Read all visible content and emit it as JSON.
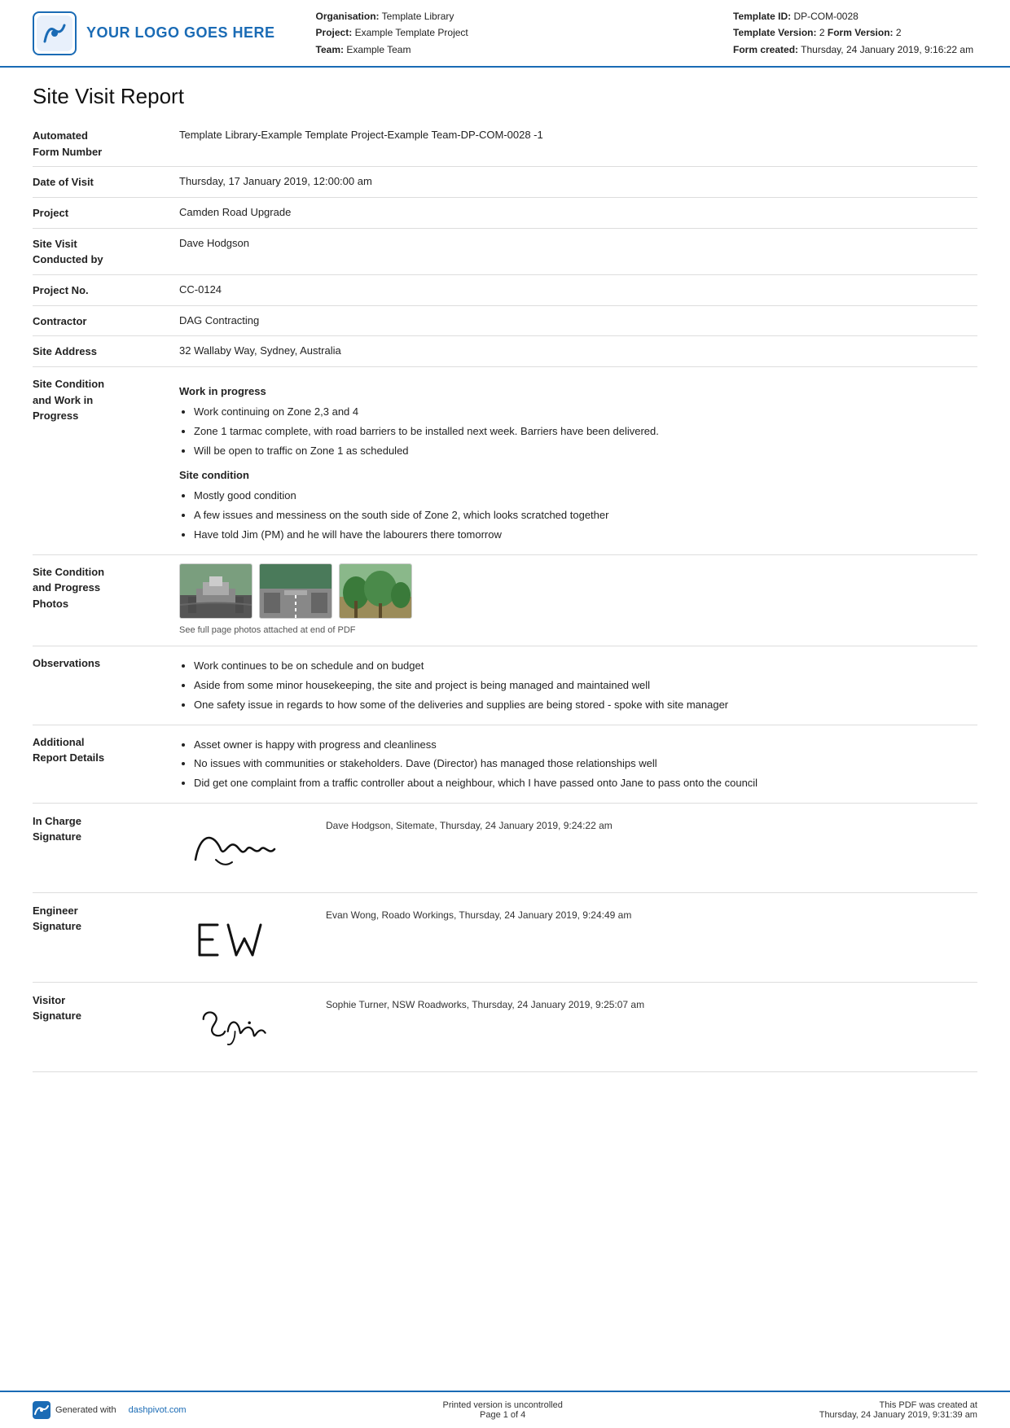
{
  "header": {
    "logo_text": "YOUR LOGO GOES HERE",
    "org_label": "Organisation:",
    "org_value": "Template Library",
    "project_label": "Project:",
    "project_value": "Example Template Project",
    "team_label": "Team:",
    "team_value": "Example Team",
    "template_id_label": "Template ID:",
    "template_id_value": "DP-COM-0028",
    "template_version_label": "Template Version:",
    "template_version_value": "2",
    "form_version_label": "Form Version:",
    "form_version_value": "2",
    "form_created_label": "Form created:",
    "form_created_value": "Thursday, 24 January 2019, 9:16:22 am"
  },
  "title": "Site Visit Report",
  "fields": {
    "form_number_label": "Automated\nForm Number",
    "form_number_value": "Template Library-Example Template Project-Example Team-DP-COM-0028   -1",
    "date_of_visit_label": "Date of Visit",
    "date_of_visit_value": "Thursday, 17 January 2019, 12:00:00 am",
    "project_label": "Project",
    "project_value": "Camden Road Upgrade",
    "site_visit_label": "Site Visit\nConducted by",
    "site_visit_value": "Dave Hodgson",
    "project_no_label": "Project No.",
    "project_no_value": "CC-0124",
    "contractor_label": "Contractor",
    "contractor_value": "DAG Contracting",
    "site_address_label": "Site Address",
    "site_address_value": "32 Wallaby Way, Sydney, Australia",
    "site_condition_label": "Site Condition\nand Work in\nProgress",
    "site_condition_heading1": "Work in progress",
    "site_condition_bullets1": [
      "Work continuing on Zone 2,3 and 4",
      "Zone 1 tarmac complete, with road barriers to be installed next week. Barriers have been delivered.",
      "Will be open to traffic on Zone 1 as scheduled"
    ],
    "site_condition_heading2": "Site condition",
    "site_condition_bullets2": [
      "Mostly good condition",
      "A few issues and messiness on the south side of Zone 2, which looks scratched together",
      "Have told Jim (PM) and he will have the labourers there tomorrow"
    ],
    "photos_label": "Site Condition\nand Progress\nPhotos",
    "photos_caption": "See full page photos attached at end of PDF",
    "observations_label": "Observations",
    "observations_bullets": [
      "Work continues to be on schedule and on budget",
      "Aside from some minor housekeeping, the site and project is being managed and maintained well",
      "One safety issue in regards to how some of the deliveries and supplies are being stored - spoke with site manager"
    ],
    "additional_label": "Additional\nReport Details",
    "additional_bullets": [
      "Asset owner is happy with progress and cleanliness",
      "No issues with communities or stakeholders. Dave (Director) has managed those relationships well",
      "Did get one complaint from a traffic controller about a neighbour, which I have passed onto Jane to pass onto the council"
    ]
  },
  "signatures": {
    "in_charge_label": "In Charge\nSignature",
    "in_charge_info": "Dave Hodgson, Sitemate, Thursday, 24 January 2019, 9:24:22 am",
    "engineer_label": "Engineer\nSignature",
    "engineer_info": "Evan Wong, Roado Workings, Thursday, 24 January 2019, 9:24:49 am",
    "visitor_label": "Visitor\nSignature",
    "visitor_info": "Sophie Turner, NSW Roadworks, Thursday, 24 January 2019, 9:25:07 am"
  },
  "footer": {
    "generated_text": "Generated with",
    "generated_link": "dashpivot.com",
    "printed_text": "Printed version is uncontrolled",
    "page_text": "Page 1 of 4",
    "pdf_created_label": "This PDF was created at",
    "pdf_created_value": "Thursday, 24 January 2019, 9:31:39 am"
  }
}
